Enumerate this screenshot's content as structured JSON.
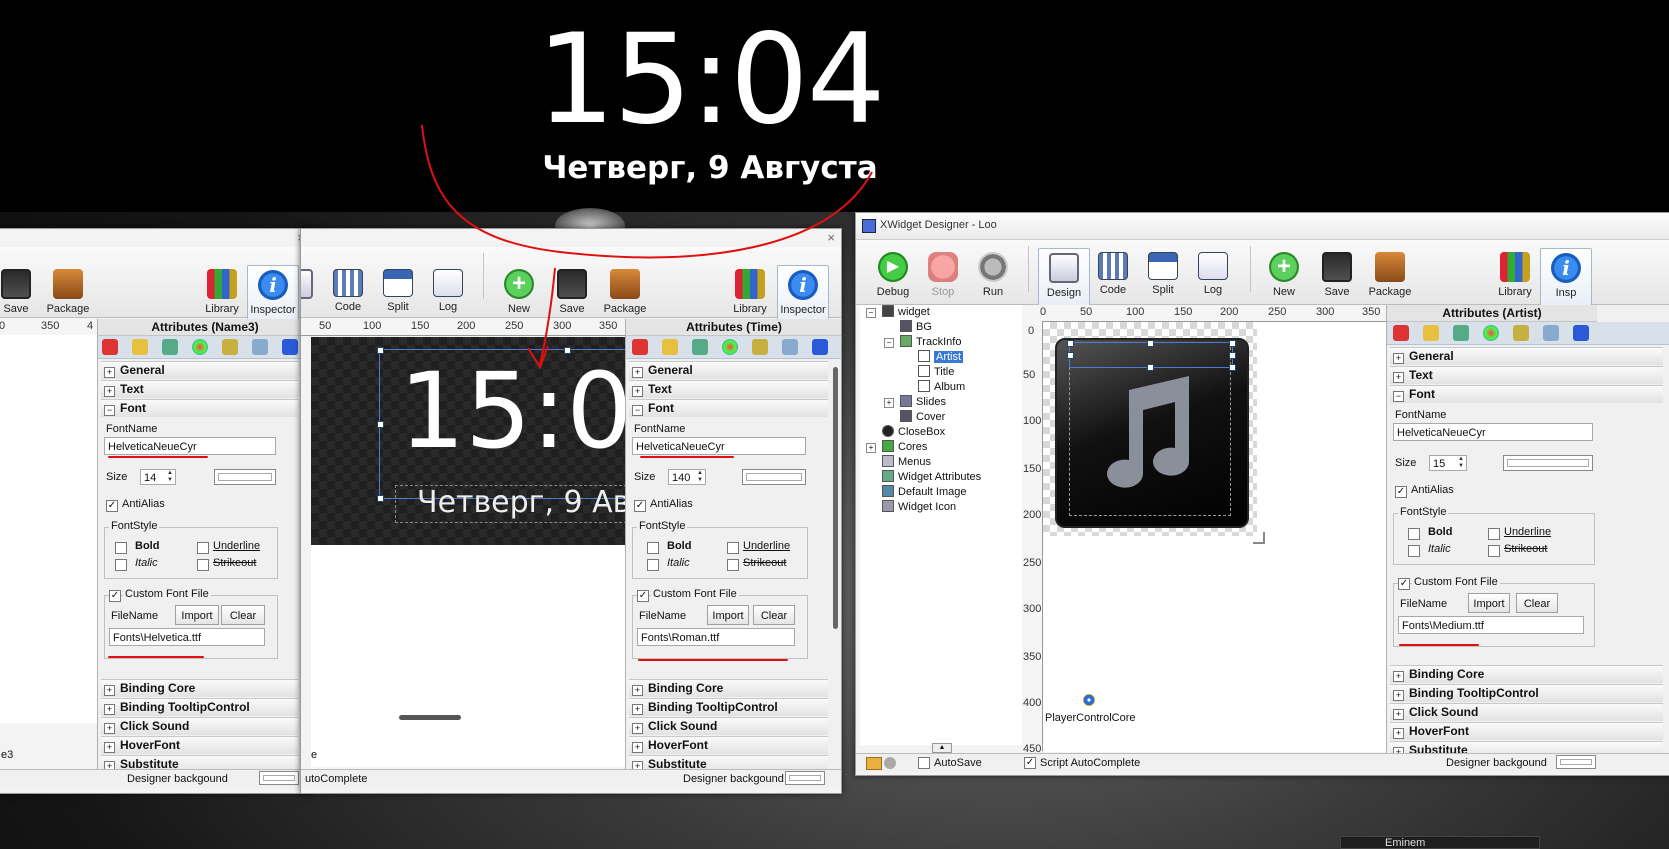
{
  "lockscreen": {
    "time": "15:04",
    "date": "Четверг, 9 Августа"
  },
  "left_window": {
    "toolbar": {
      "save": "Save",
      "package": "Package",
      "library": "Library",
      "inspector": "Inspector",
      "cut_label": ""
    },
    "ruler": [
      "0",
      "350",
      "4"
    ],
    "attributes": {
      "title": "Attributes (Name3)",
      "sections": [
        "General",
        "Text",
        "Font"
      ],
      "font_name_label": "FontName",
      "font_name": "HelveticaNeueCyr",
      "size_label": "Size",
      "size": "14",
      "antialias": "AntiAlias",
      "fontstyle": "FontStyle",
      "bold": "Bold",
      "underline": "Underline",
      "italic": "Italic",
      "strikeout": "Strikeout",
      "custom_font": "Custom Font File",
      "filename_label": "FileName",
      "import": "Import",
      "clear": "Clear",
      "file": "Fonts\\Helvetica.ttf",
      "bottom_sections": [
        "Binding Core",
        "Binding TooltipControl",
        "Click Sound",
        "HoverFont",
        "Substitute"
      ]
    },
    "status": {
      "left": "e3",
      "designer_bg": "Designer backgound"
    }
  },
  "mid_window": {
    "toolbar": {
      "code": "Code",
      "split": "Split",
      "log": "Log",
      "new": "New",
      "save": "Save",
      "package": "Package",
      "library": "Library",
      "inspector": "Inspector",
      "design_cut": "n"
    },
    "ruler": [
      "50",
      "100",
      "150",
      "200",
      "250",
      "300",
      "350"
    ],
    "preview": {
      "time": "15:0",
      "date": "Четверг, 9 Ав"
    },
    "attributes": {
      "title": "Attributes (Time)",
      "sections": [
        "General",
        "Text",
        "Font"
      ],
      "font_name_label": "FontName",
      "font_name": "HelveticaNeueCyr",
      "size_label": "Size",
      "size": "140",
      "antialias": "AntiAlias",
      "fontstyle": "FontStyle",
      "bold": "Bold",
      "underline": "Underline",
      "italic": "Italic",
      "strikeout": "Strikeout",
      "custom_font": "Custom Font File",
      "filename_label": "FileName",
      "import": "Import",
      "clear": "Clear",
      "file": "Fonts\\Roman.ttf",
      "bottom_sections": [
        "Binding Core",
        "Binding TooltipControl",
        "Click Sound",
        "HoverFont",
        "Substitute"
      ]
    },
    "status": {
      "left_e": "e",
      "autocomplete": "utoComplete",
      "designer_bg": "Designer backgound"
    }
  },
  "right_window": {
    "title": "XWidget Designer - Loo",
    "toolbar": {
      "debug": "Debug",
      "stop": "Stop",
      "run": "Run",
      "design": "Design",
      "code": "Code",
      "split": "Split",
      "log": "Log",
      "new": "New",
      "save": "Save",
      "package": "Package",
      "library": "Library",
      "inspector_cut": "Insp"
    },
    "tree": [
      {
        "label": "widget"
      },
      {
        "label": "BG"
      },
      {
        "label": "TrackInfo"
      },
      {
        "label": "Artist"
      },
      {
        "label": "Title"
      },
      {
        "label": "Album"
      },
      {
        "label": "Slides"
      },
      {
        "label": "Cover"
      },
      {
        "label": "CloseBox"
      },
      {
        "label": "Cores"
      },
      {
        "label": "Menus"
      },
      {
        "label": "Widget Attributes"
      },
      {
        "label": "Default Image"
      },
      {
        "label": "Widget Icon"
      }
    ],
    "ruler": [
      "0",
      "50",
      "100",
      "150",
      "200",
      "250",
      "300",
      "350"
    ],
    "vruler": [
      "0",
      "50",
      "100",
      "150",
      "200",
      "250",
      "300",
      "350",
      "400",
      "450"
    ],
    "core_label": "PlayerControlCore",
    "attributes": {
      "title": "Attributes (Artist)",
      "sections": [
        "General",
        "Text",
        "Font"
      ],
      "font_name_label": "FontName",
      "font_name": "HelveticaNeueCyr",
      "size_label": "Size",
      "size": "15",
      "antialias": "AntiAlias",
      "fontstyle": "FontStyle",
      "bold": "Bold",
      "underline": "Underline",
      "italic": "Italic",
      "strikeout": "Strikeout",
      "custom_font": "Custom Font File",
      "filename_label": "FileName",
      "import": "Import",
      "clear": "Clear",
      "file": "Fonts\\Medium.ttf",
      "bottom_sections": [
        "Binding Core",
        "Binding TooltipControl",
        "Click Sound",
        "HoverFont",
        "Substitute"
      ]
    },
    "status": {
      "autosave": "AutoSave",
      "script_ac": "Script AutoComplete",
      "designer_bg": "Designer backgound"
    }
  },
  "taskbar": {
    "item": "Eminem"
  }
}
